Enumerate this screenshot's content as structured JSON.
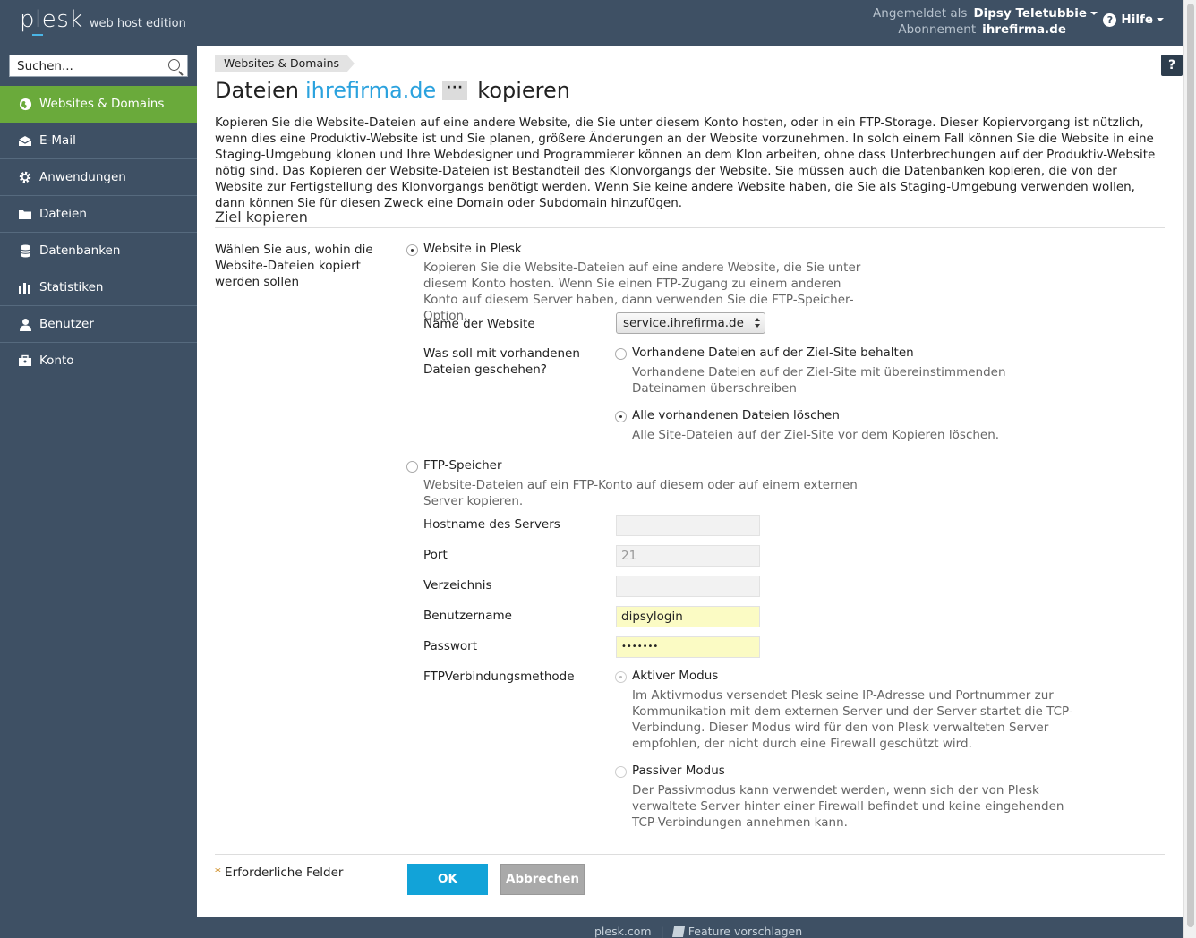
{
  "header": {
    "logo_word": "plesk",
    "logo_edition": "web host edition",
    "logged_in_label": "Angemeldet als",
    "logged_in_user": "Dipsy Teletubbie",
    "subscription_label": "Abonnement",
    "subscription_value": "ihrefirma.de",
    "help_label": "Hilfe"
  },
  "sidebar": {
    "search_placeholder": "Suchen...",
    "items": [
      {
        "label": "Websites & Domains",
        "icon": "globe-icon",
        "active": true
      },
      {
        "label": "E-Mail",
        "icon": "mail-icon"
      },
      {
        "label": "Anwendungen",
        "icon": "gear-icon"
      },
      {
        "label": "Dateien",
        "icon": "folder-icon"
      },
      {
        "label": "Datenbanken",
        "icon": "database-icon"
      },
      {
        "label": "Statistiken",
        "icon": "bar-chart-icon"
      },
      {
        "label": "Benutzer",
        "icon": "user-icon"
      },
      {
        "label": "Konto",
        "icon": "briefcase-icon"
      }
    ]
  },
  "main": {
    "breadcrumb": "Websites & Domains",
    "help_button": "?",
    "title_prefix": "Dateien",
    "title_domain": "ihrefirma.de",
    "title_more": "···",
    "title_suffix": "kopieren",
    "intro": "Kopieren Sie die Website-Dateien auf eine andere Website, die Sie unter diesem Konto hosten, oder in ein FTP-Storage. Dieser Kopiervorgang ist nützlich, wenn dies eine Produktiv-Website ist und Sie planen, größere Änderungen an der Website vorzunehmen. In solch einem Fall können Sie die Website in eine Staging-Umgebung klonen und Ihre Webdesigner und Programmierer können an dem Klon arbeiten, ohne dass Unterbrechungen auf der Produktiv-Website nötig sind. Das Kopieren der Website-Dateien ist Bestandteil des Klonvorgangs der Website. Sie müssen auch die Datenbanken kopieren, die von der Website zur Fertigstellung des Klonvorgangs benötigt werden. Wenn Sie keine andere Website haben, die Sie als Staging-Umgebung verwenden wollen, dann können Sie für diesen Zweck eine Domain oder Subdomain hinzufügen.",
    "section_title": "Ziel kopieren",
    "target_label": "Wählen Sie aus, wohin die Website-Dateien kopiert werden sollen",
    "option_plesk": {
      "label": "Website in Plesk",
      "description": "Kopieren Sie die Website-Dateien auf eine andere Website, die Sie unter diesem Konto hosten. Wenn Sie einen FTP-Zugang zu einem anderen Konto auf diesem Server haben, dann verwenden Sie die FTP-Speicher-Option.",
      "site_name_label": "Name der Website",
      "site_name_value": "service.ihrefirma.de",
      "existing_label": "Was soll mit vorhandenen Dateien geschehen?",
      "keep_label": "Vorhandene Dateien auf der Ziel-Site behalten",
      "keep_desc": "Vorhandene Dateien auf der Ziel-Site mit übereinstimmenden Dateinamen überschreiben",
      "delete_label": "Alle vorhandenen Dateien löschen",
      "delete_desc": "Alle Site-Dateien auf der Ziel-Site vor dem Kopieren löschen."
    },
    "option_ftp": {
      "label": "FTP-Speicher",
      "description": "Website-Dateien auf ein FTP-Konto auf diesem oder auf einem externen Server kopieren.",
      "host_label": "Hostname des Servers",
      "host_value": "",
      "port_label": "Port",
      "port_value": "21",
      "dir_label": "Verzeichnis",
      "dir_value": "",
      "user_label": "Benutzername",
      "user_value": "dipsylogin",
      "pass_label": "Passwort",
      "pass_value": "•••••••",
      "method_label": "FTPVerbindungsmethode",
      "active_label": "Aktiver Modus",
      "active_desc": "Im Aktivmodus versendet Plesk seine IP-Adresse und Portnummer zur Kommunikation mit dem externen Server und der Server startet die TCP-Verbindung. Dieser Modus wird für den von Plesk verwalteten Server empfohlen, der nicht durch eine Firewall geschützt wird.",
      "passive_label": "Passiver Modus",
      "passive_desc": "Der Passivmodus kann verwendet werden, wenn sich der von Plesk verwaltete Server hinter einer Firewall befindet und keine eingehenden TCP-Verbindungen annehmen kann."
    },
    "required_star": "*",
    "required_label": "Erforderliche Felder",
    "ok_label": "OK",
    "cancel_label": "Abbrechen"
  },
  "footer": {
    "link1": "plesk.com",
    "separator": "|",
    "link2": "Feature vorschlagen"
  },
  "colors": {
    "sidebar": "#3e5064",
    "active": "#6aaa3b",
    "accent": "#2ba2de",
    "ok_button": "#12a3d8"
  }
}
